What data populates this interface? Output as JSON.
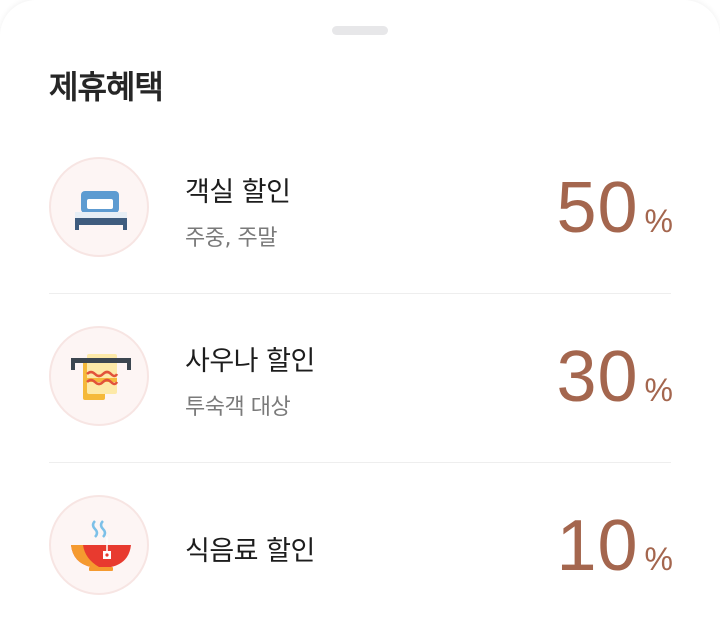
{
  "sheet": {
    "title": "제휴혜택"
  },
  "benefits": [
    {
      "name": "객실 할인",
      "subtitle": "주중, 주말",
      "value": "50",
      "unit": "%",
      "icon": "bed-icon"
    },
    {
      "name": "사우나 할인",
      "subtitle": "투숙객 대상",
      "value": "30",
      "unit": "%",
      "icon": "towel-icon"
    },
    {
      "name": "식음료 할인",
      "subtitle": "",
      "value": "10",
      "unit": "%",
      "icon": "hot-tea-icon"
    }
  ],
  "colors": {
    "accent": "#a4664e",
    "icon_bg": "#fdf5f4",
    "icon_border": "#f7e5e3",
    "divider": "#eeeeee"
  }
}
